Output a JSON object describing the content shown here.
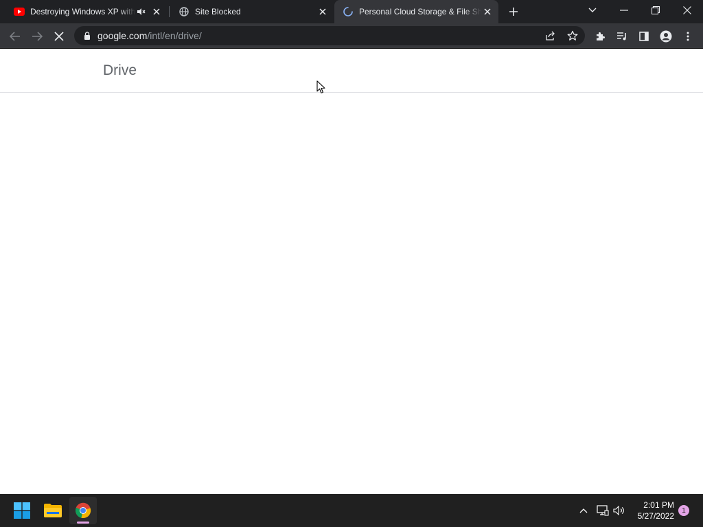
{
  "browser": {
    "tabs": [
      {
        "title": "Destroying Windows XP with",
        "favicon": "youtube-icon",
        "audio": "muted",
        "active": false
      },
      {
        "title": "Site Blocked",
        "favicon": "globe-icon",
        "active": false
      },
      {
        "title": "Personal Cloud Storage & File Sh",
        "favicon": "loading-spinner-icon",
        "active": true
      }
    ],
    "address_bar": {
      "host": "google.com",
      "path": "/intl/en/drive/"
    }
  },
  "page": {
    "header_title": "Drive"
  },
  "taskbar": {
    "pinned_apps": [
      "windows-start-icon",
      "file-explorer-icon",
      "chrome-icon"
    ],
    "clock": {
      "time": "2:01 PM",
      "date": "5/27/2022"
    },
    "notification_count": "1"
  },
  "colors": {
    "tabstrip_bg": "#202124",
    "active_tab_bg": "#35363a",
    "omnibox_bg": "#202124",
    "taskbar_bg": "#202020",
    "accent": "#e3a4e6"
  }
}
